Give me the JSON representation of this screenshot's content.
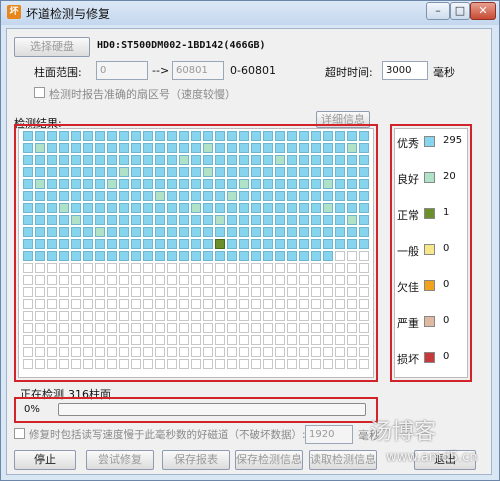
{
  "window": {
    "title": "坏道检测与修复",
    "app_icon": "app-icon",
    "controls": {
      "minimize": "–",
      "maximize": "□",
      "close": "✕"
    }
  },
  "disk": {
    "select_button": "选择硬盘",
    "name": "HD0:ST500DM002-1BD142(466GB)"
  },
  "range": {
    "label": "柱面范围:",
    "from": "0",
    "arrow": "-->",
    "to": "60801",
    "span": "0-60801"
  },
  "timeout": {
    "label": "超时时间:",
    "value": "3000",
    "unit": "毫秒"
  },
  "option_report_sector": "检测时报告准确的扇区号（速度较慢）",
  "results": {
    "label": "检测结果:",
    "details_button": "详细信息"
  },
  "grid": {
    "columns": 29,
    "rows": 20,
    "scanned_cells": 316,
    "colors": {
      "excellent": "#86d4ee",
      "good": "#b0e2c8",
      "normal": "#6b8f2a",
      "unscanned": "#ffffff"
    },
    "good_cells": [
      30,
      44,
      56,
      71,
      79,
      95,
      102,
      117,
      123,
      134,
      141,
      156,
      162,
      177,
      188,
      199,
      207,
      219,
      230,
      238
    ],
    "normal_cells": [
      277
    ]
  },
  "legend": [
    {
      "name": "优秀",
      "color": "#86d4ee",
      "count": "295"
    },
    {
      "name": "良好",
      "color": "#b0e2c8",
      "count": "20"
    },
    {
      "name": "正常",
      "color": "#6b8f2a",
      "count": "1"
    },
    {
      "name": "一般",
      "color": "#f6e88a",
      "count": "0"
    },
    {
      "name": "欠佳",
      "color": "#f2a21c",
      "count": "0"
    },
    {
      "name": "严重",
      "color": "#dfb9a0",
      "count": "0"
    },
    {
      "name": "损坏",
      "color": "#c6393a",
      "count": "0"
    }
  ],
  "status": {
    "label": "正在检测",
    "value": "316柱面"
  },
  "progress": {
    "text": "0%",
    "fraction": 0
  },
  "option_repair": {
    "label": "修复时包括读写速度慢于此毫秒数的好磁道（不破坏数据）:",
    "value": "1920",
    "unit": "毫秒"
  },
  "buttons": {
    "stop": "停止",
    "try_repair": "尝试修复",
    "save_report": "保存报表",
    "save_info": "保存检测信息",
    "read_info": "读取检测信息",
    "exit": "退出"
  },
  "watermark": {
    "name": "汤博客",
    "url": "www.amd5.cn"
  }
}
